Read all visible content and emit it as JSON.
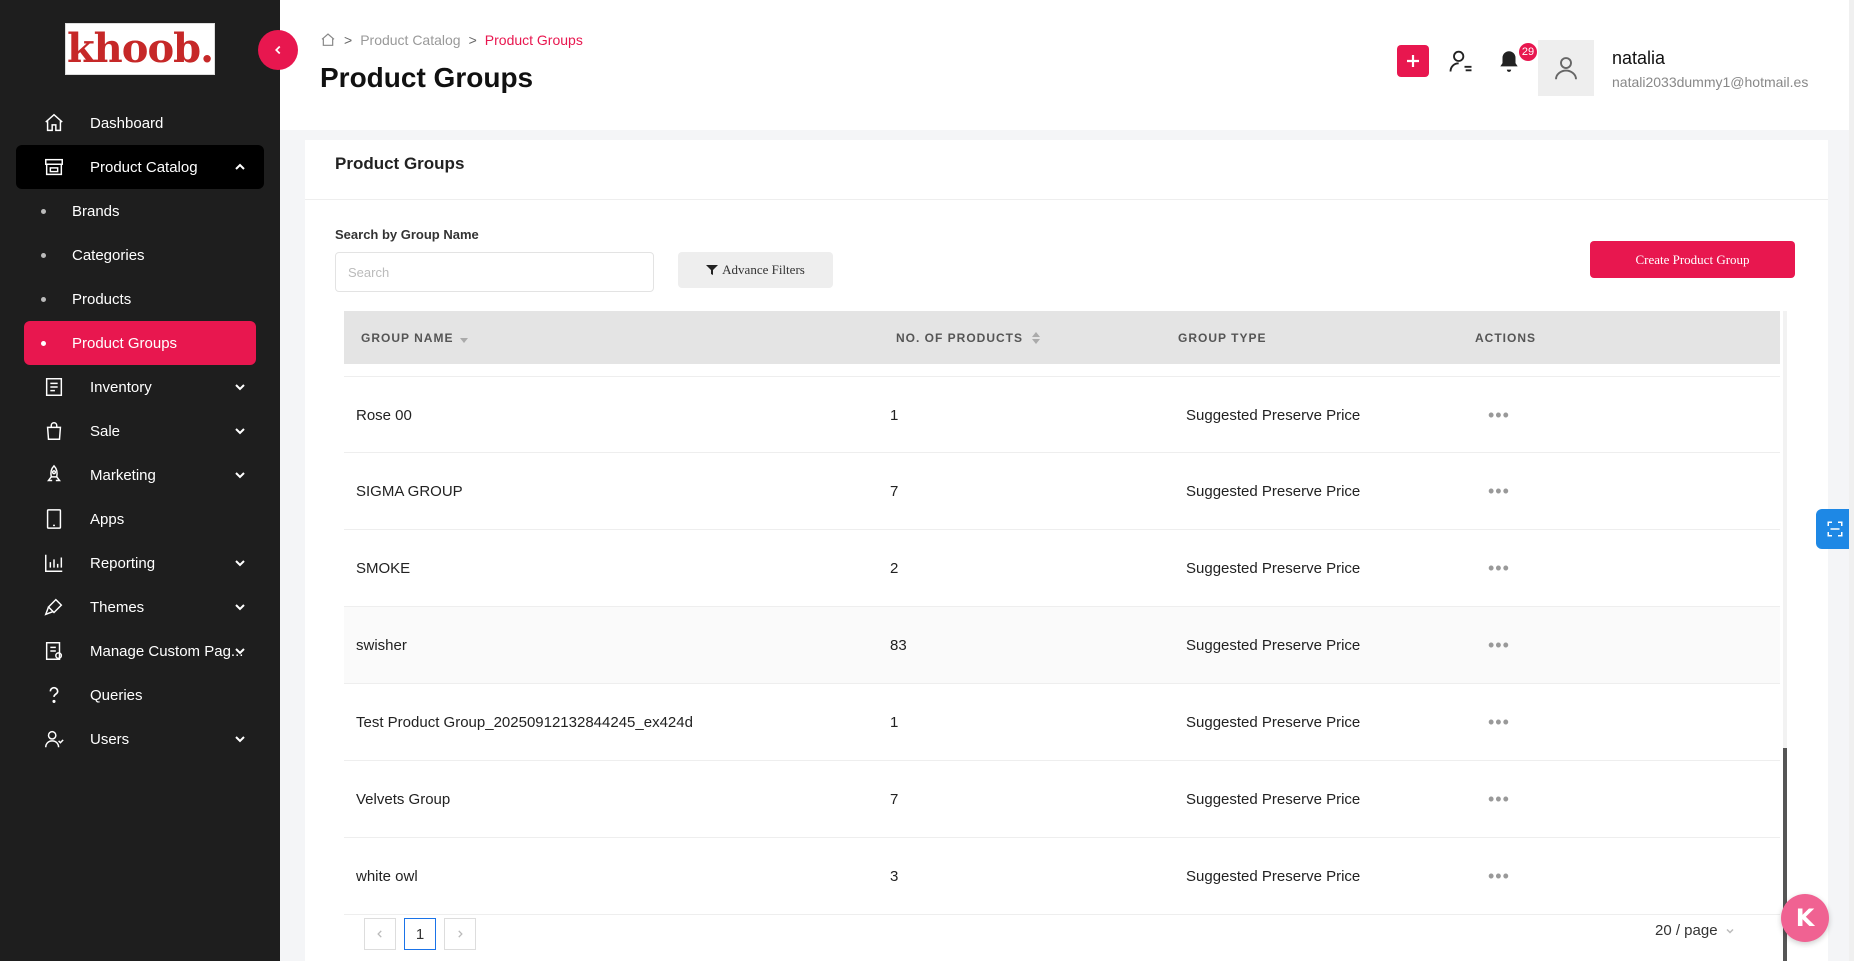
{
  "brand": {
    "logo_text": "khoob."
  },
  "sidebar": {
    "items": [
      {
        "label": "Dashboard",
        "icon": "home-icon"
      },
      {
        "label": "Product Catalog",
        "icon": "store-icon",
        "expanded": true,
        "children": [
          {
            "label": "Brands"
          },
          {
            "label": "Categories"
          },
          {
            "label": "Products"
          },
          {
            "label": "Product Groups",
            "selected": true
          }
        ]
      },
      {
        "label": "Inventory",
        "icon": "inventory-icon"
      },
      {
        "label": "Sale",
        "icon": "shopping-bag-icon"
      },
      {
        "label": "Marketing",
        "icon": "rocket-icon"
      },
      {
        "label": "Apps",
        "icon": "tablet-icon"
      },
      {
        "label": "Reporting",
        "icon": "bar-chart-icon"
      },
      {
        "label": "Themes",
        "icon": "brush-icon"
      },
      {
        "label": "Manage Custom Pag...",
        "icon": "document-icon"
      },
      {
        "label": "Queries",
        "icon": "question-icon"
      },
      {
        "label": "Users",
        "icon": "users-icon"
      }
    ]
  },
  "header": {
    "breadcrumb": [
      "Product Catalog",
      "Product Groups"
    ],
    "title": "Product Groups",
    "notification_count": "29",
    "user": {
      "name": "natalia",
      "email": "natali2033dummy1@hotmail.es"
    }
  },
  "main": {
    "card_title": "Product Groups",
    "search_label": "Search by Group Name",
    "search_placeholder": "Search",
    "search_value": "",
    "filter_button": "Advance Filters",
    "create_button": "Create Product Group",
    "columns": [
      "GROUP NAME",
      "NO. OF PRODUCTS",
      "GROUP TYPE",
      "ACTIONS"
    ],
    "rows": [
      {
        "name": "Rose 00",
        "count": "1",
        "type": "Suggested Preserve Price"
      },
      {
        "name": "SIGMA GROUP",
        "count": "7",
        "type": "Suggested Preserve Price"
      },
      {
        "name": "SMOKE",
        "count": "2",
        "type": "Suggested Preserve Price"
      },
      {
        "name": "swisher",
        "count": "83",
        "type": "Suggested Preserve Price"
      },
      {
        "name": "Test Product Group_20250912132844245_ex424d",
        "count": "1",
        "type": "Suggested Preserve Price"
      },
      {
        "name": "Velvets Group",
        "count": "7",
        "type": "Suggested Preserve Price"
      },
      {
        "name": "white owl",
        "count": "3",
        "type": "Suggested Preserve Price"
      }
    ],
    "actions_glyph": "•••",
    "pagination": {
      "current_page": "1",
      "per_page": "20 / page"
    }
  },
  "colors": {
    "accent": "#e8174f",
    "sidebar_bg": "#1e1e1e",
    "table_header_bg": "#e4e4e4"
  }
}
